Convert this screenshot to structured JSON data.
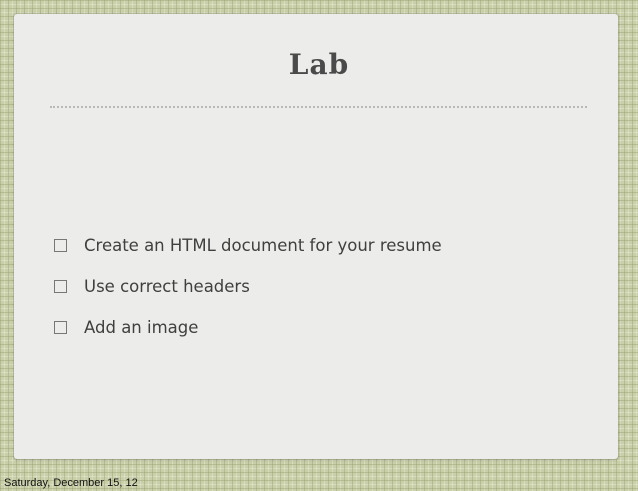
{
  "slide": {
    "title": "Lab",
    "bullets": [
      "Create an HTML document for your resume",
      "Use correct headers",
      "Add an image"
    ]
  },
  "footer": {
    "date_text": "Saturday, December 15, 12"
  },
  "colors": {
    "background": "#c9cfa8",
    "card": "#ececea",
    "text": "#3f3f3f"
  }
}
